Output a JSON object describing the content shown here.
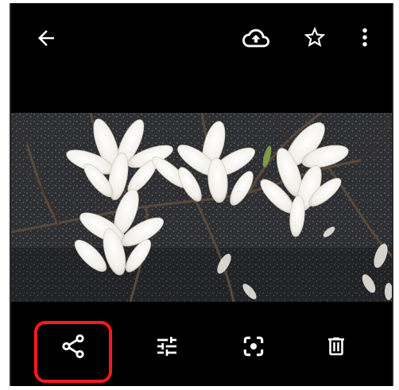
{
  "app": {
    "screen": "photo-viewer"
  },
  "colors": {
    "background": "#000000",
    "icon": "#ffffff",
    "highlight": "#ff1a1a"
  },
  "top_bar": {
    "icons": [
      "back-arrow-icon",
      "cloud-upload-icon",
      "star-icon",
      "more-vert-icon"
    ]
  },
  "bottom_bar": {
    "icons": [
      "share-icon",
      "edit-adjust-icon",
      "lens-icon",
      "delete-icon"
    ],
    "highlighted": "share-icon"
  }
}
